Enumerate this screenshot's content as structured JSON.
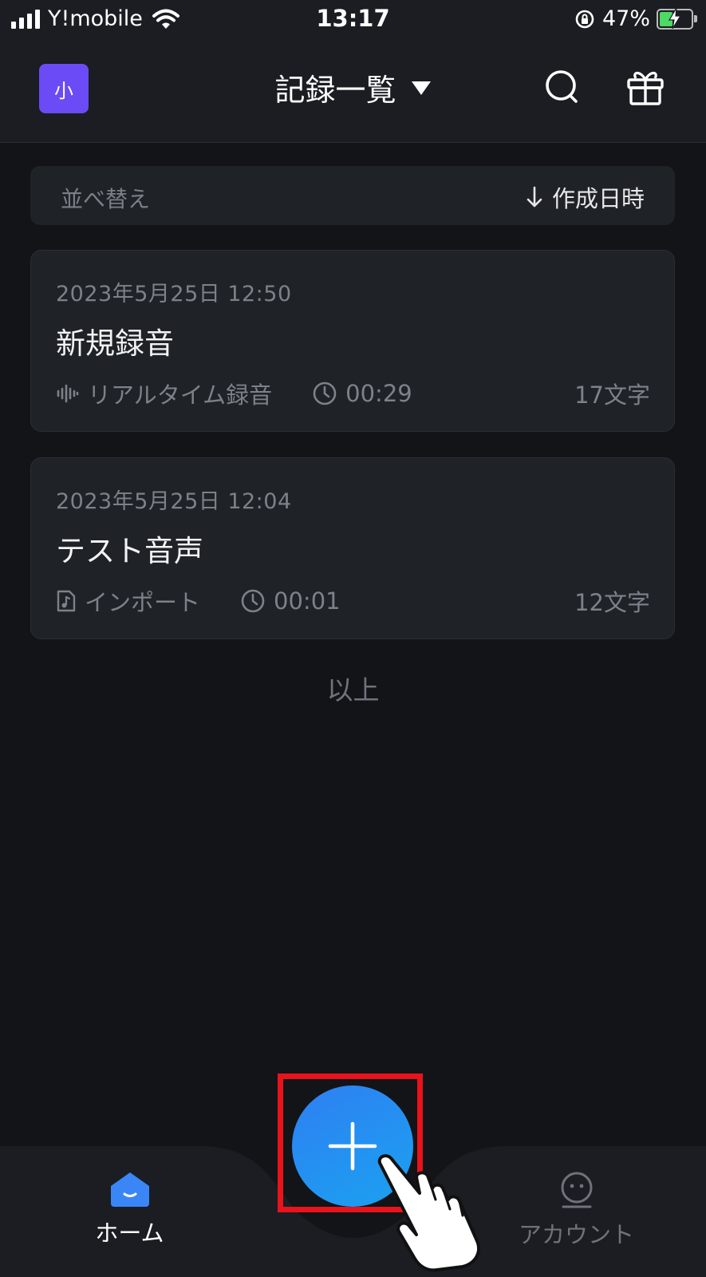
{
  "status_bar": {
    "carrier": "Y!mobile",
    "time": "13:17",
    "battery": "47%"
  },
  "header": {
    "avatar_text": "小",
    "title": "記録一覧",
    "icons": [
      "dropdown-caret-icon",
      "search-icon",
      "gift-icon"
    ]
  },
  "sort": {
    "label": "並べ替え",
    "value": "作成日時",
    "icon": "arrow-down-icon"
  },
  "records": [
    {
      "date": "2023年5月25日  12:50",
      "title": "新規録音",
      "source": "リアルタイム録音",
      "source_icon": "waveform-icon",
      "duration": "00:29",
      "chars": "17文字"
    },
    {
      "date": "2023年5月25日  12:04",
      "title": "テスト音声",
      "source": "インポート",
      "source_icon": "audio-file-icon",
      "duration": "00:01",
      "chars": "12文字"
    }
  ],
  "list_end": "以上",
  "nav": {
    "home": "ホーム",
    "account": "アカウント"
  },
  "colors": {
    "background": "#121418",
    "surface": "#1f2227",
    "accent": "#2f7ff2",
    "avatar": "#6b4bf5",
    "highlight": "#e8131b"
  }
}
